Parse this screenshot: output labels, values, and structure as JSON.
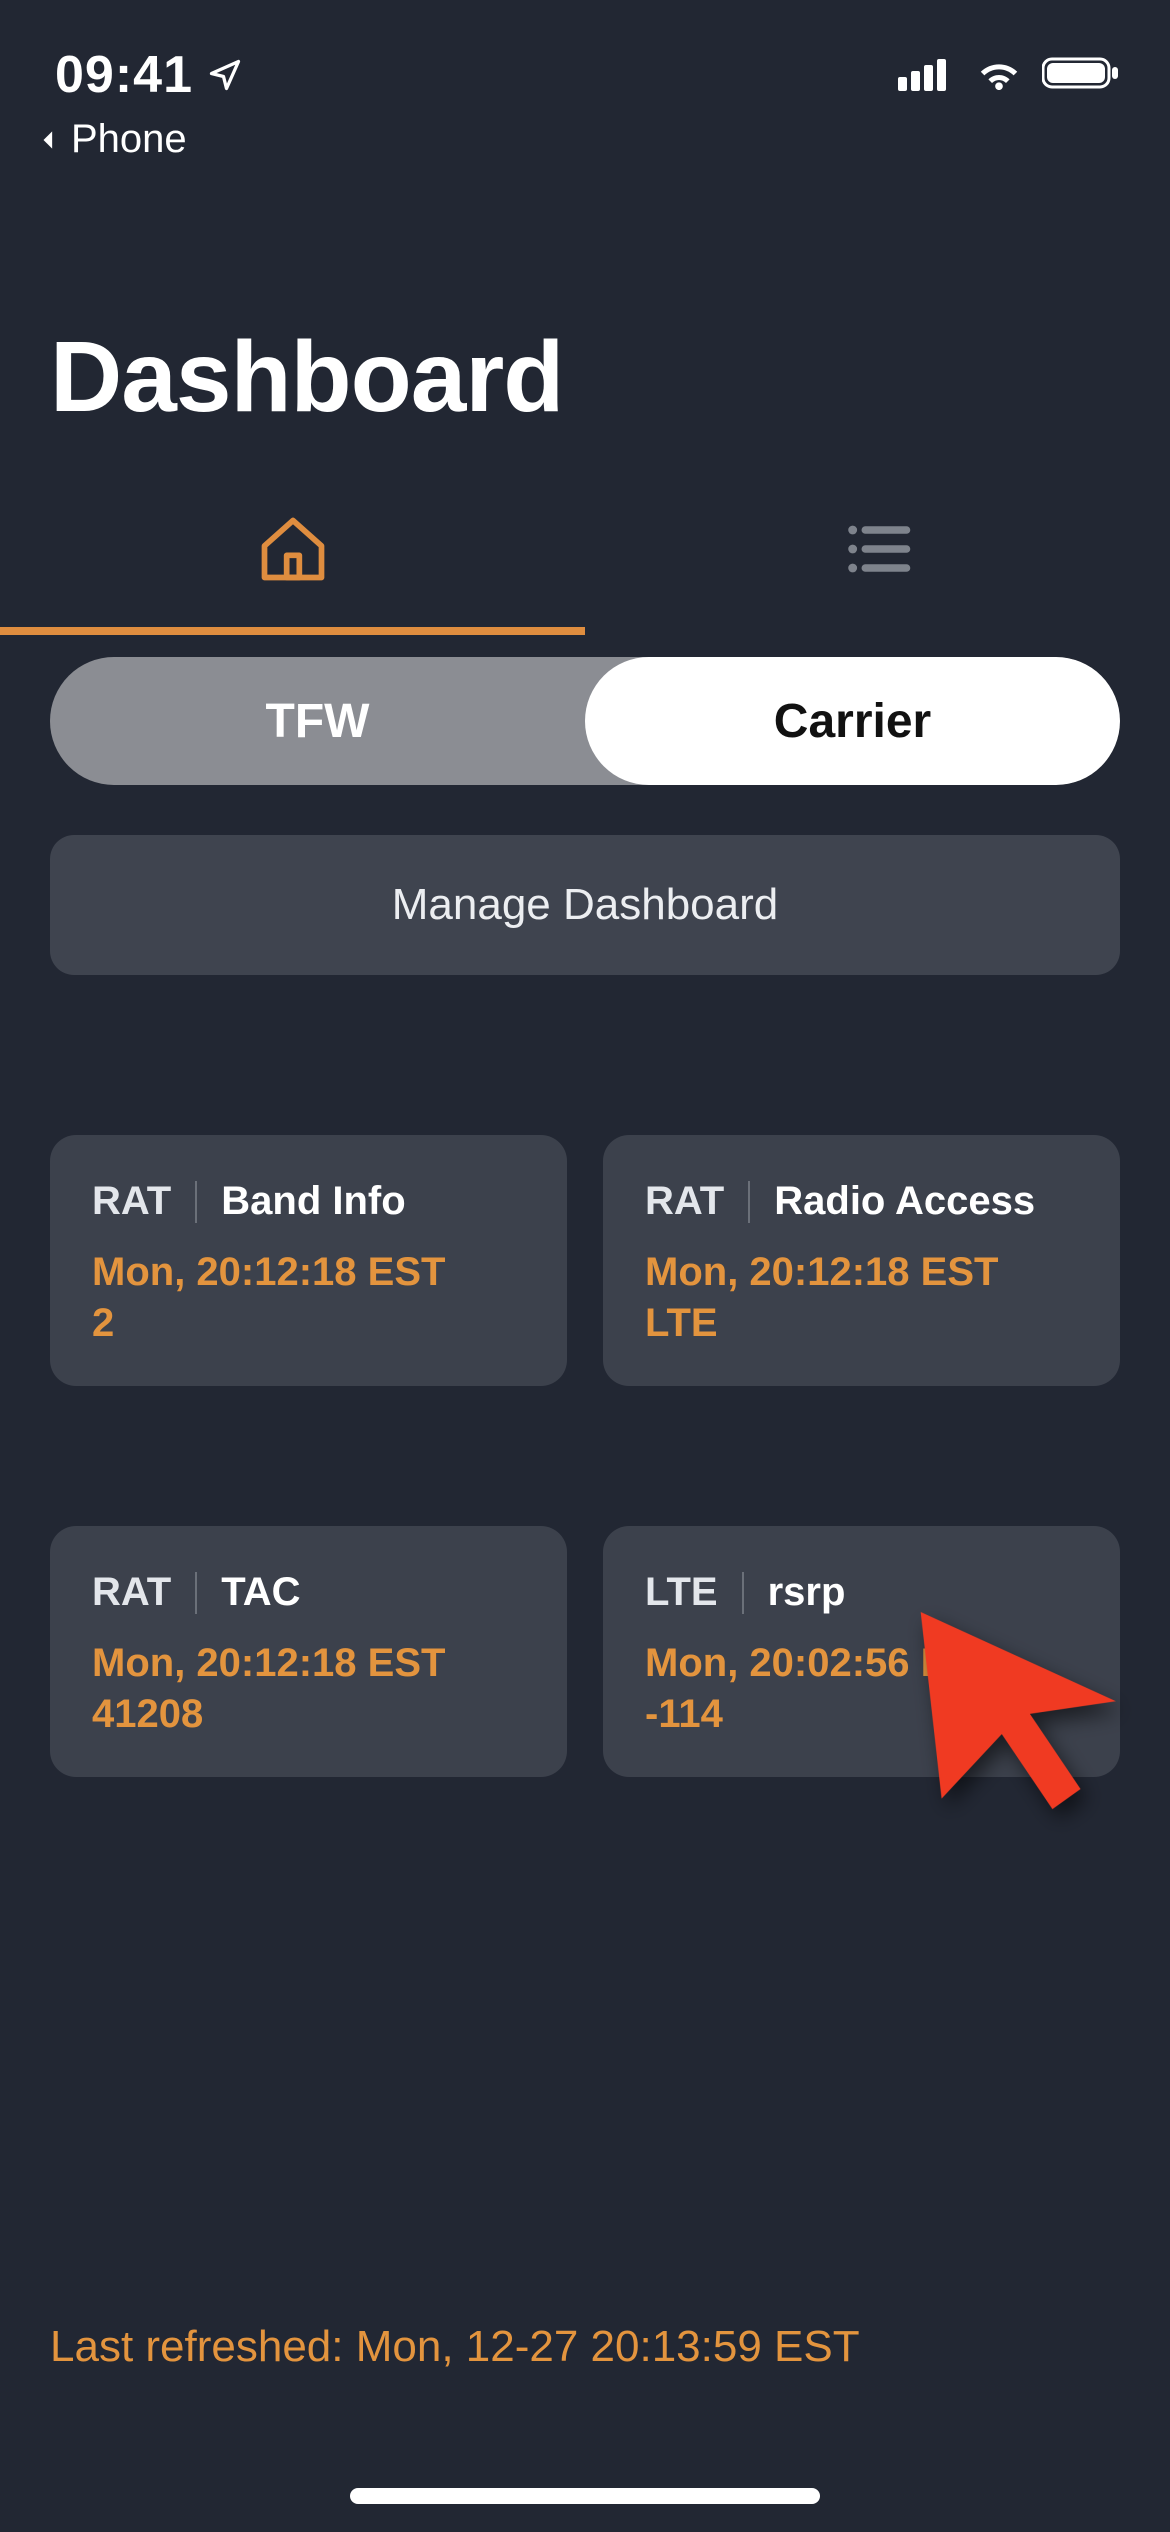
{
  "statusbar": {
    "time": "09:41",
    "back_app": "Phone"
  },
  "page_title": "Dashboard",
  "segmented": {
    "left": "TFW",
    "right": "Carrier"
  },
  "manage_label": "Manage Dashboard",
  "cards": [
    {
      "category": "RAT",
      "title": "Band Info",
      "timestamp": "Mon, 20:12:18 EST",
      "value": "2"
    },
    {
      "category": "RAT",
      "title": "Radio Access",
      "timestamp": "Mon, 20:12:18 EST",
      "value": "LTE"
    },
    {
      "category": "RAT",
      "title": "TAC",
      "timestamp": "Mon, 20:12:18 EST",
      "value": "41208"
    },
    {
      "category": "LTE",
      "title": "rsrp",
      "timestamp": "Mon, 20:02:56 EST",
      "value": "-114"
    }
  ],
  "footer": "Last refreshed: Mon, 12-27 20:13:59 EST",
  "colors": {
    "accent": "#e3943e",
    "bg": "#222733",
    "card": "#3c414c"
  }
}
